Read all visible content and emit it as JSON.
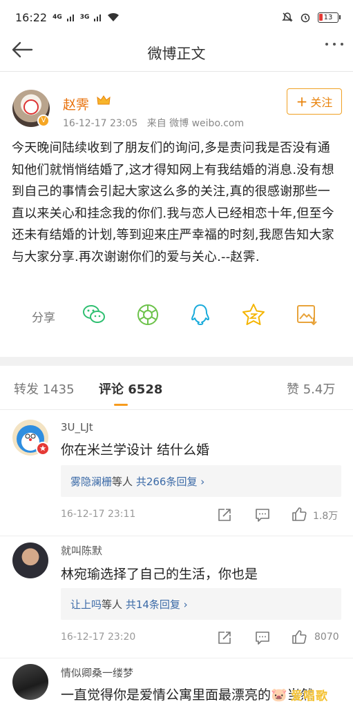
{
  "status_bar": {
    "time": "16:22",
    "net1": "4G",
    "net2": "3G",
    "battery": "13"
  },
  "nav": {
    "title": "微博正文"
  },
  "post": {
    "author": "赵霁",
    "timestamp": "16-12-17 23:05",
    "source": "来自 微博 weibo.com",
    "follow_label": "关注",
    "text": "今天晚间陆续收到了朋友们的询问,多是责问我是否没有通知他们就悄悄结婚了,这才得知网上有我结婚的消息.没有想到自己的事情会引起大家这么多的关注,真的很感谢那些一直以来关心和挂念我的你们.我与恋人已经相恋十年,但至今还未有结婚的计划,等到迎来庄严幸福的时刻,我愿告知大家与大家分享.再次谢谢你们的爱与关心.--赵霁.",
    "share_label": "分享",
    "share_targets": [
      "wechat-icon",
      "moments-icon",
      "qq-icon",
      "qzone-icon",
      "save-image-icon"
    ]
  },
  "tabs": {
    "repost": "转发 1435",
    "comment": "评论 6528",
    "like": "赞 5.4万"
  },
  "comments": [
    {
      "user": "3U_LJt",
      "text": "你在米兰学设计 结什么婚",
      "reply_user": "雾隐澜栅",
      "reply_etc": "等人",
      "reply_count": "共266条回复 ›",
      "time": "16-12-17 23:11",
      "likes": "1.8万"
    },
    {
      "user": "就叫陈默",
      "text": "林宛瑜选择了自己的生活，你也是",
      "reply_user": "让上吗",
      "reply_etc": "等人",
      "reply_count": "共14条回复 ›",
      "time": "16-12-17 23:20",
      "likes": "8070"
    },
    {
      "user": "情似卿桑一缕梦",
      "text": "一直觉得你是爱情公寓里面最漂亮的🐷当然"
    }
  ],
  "watermark": "爱唱歌",
  "colors": {
    "accent": "#f79b1e",
    "author": "#e8700a",
    "link": "#3b6aa7"
  }
}
